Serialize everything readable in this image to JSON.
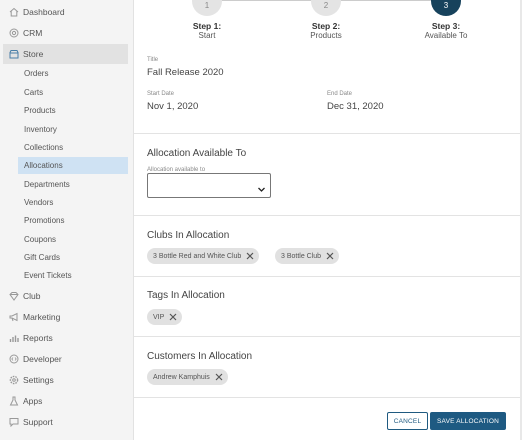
{
  "sidebar": {
    "top_items": [
      {
        "label": "Dashboard",
        "icon": "home-icon"
      },
      {
        "label": "CRM",
        "icon": "target-icon"
      },
      {
        "label": "Store",
        "icon": "store-icon"
      }
    ],
    "store_items": [
      "Orders",
      "Carts",
      "Products",
      "Inventory",
      "Collections",
      "Allocations",
      "Departments",
      "Vendors",
      "Promotions",
      "Coupons",
      "Gift Cards",
      "Event Tickets"
    ],
    "bottom_items": [
      {
        "label": "Club",
        "icon": "diamond-icon"
      },
      {
        "label": "Marketing",
        "icon": "megaphone-icon"
      },
      {
        "label": "Reports",
        "icon": "bar-chart-icon"
      },
      {
        "label": "Developer",
        "icon": "code-icon"
      },
      {
        "label": "Settings",
        "icon": "gear-icon"
      },
      {
        "label": "Apps",
        "icon": "flask-icon"
      },
      {
        "label": "Support",
        "icon": "chat-icon"
      }
    ],
    "active_top": "Store",
    "active_sub": "Allocations"
  },
  "steps": [
    {
      "number": "1",
      "title": "Step 1:",
      "subtitle": "Start"
    },
    {
      "number": "2",
      "title": "Step 2:",
      "subtitle": "Products"
    },
    {
      "number": "3",
      "title": "Step 3:",
      "subtitle": "Available To"
    }
  ],
  "form": {
    "title_label": "Title",
    "title_value": "Fall Release 2020",
    "start_label": "Start Date",
    "start_value": "Nov 1, 2020",
    "end_label": "End Date",
    "end_value": "Dec 31, 2020"
  },
  "available_to": {
    "heading": "Allocation Available To",
    "select_label": "Allocation available to",
    "select_value": ""
  },
  "clubs": {
    "heading": "Clubs In Allocation",
    "chips": [
      "3 Bottle Red and White Club",
      "3 Bottle Club"
    ]
  },
  "tags": {
    "heading": "Tags In Allocation",
    "chips": [
      "VIP"
    ]
  },
  "customers": {
    "heading": "Customers In Allocation",
    "chips": [
      "Andrew Kamphuis"
    ]
  },
  "actions": {
    "cancel": "CANCEL",
    "save": "SAVE ALLOCATION"
  },
  "colors": {
    "accent": "#1e5a82",
    "active_step": "#17425c",
    "active_nav": "#cfe2f3"
  }
}
